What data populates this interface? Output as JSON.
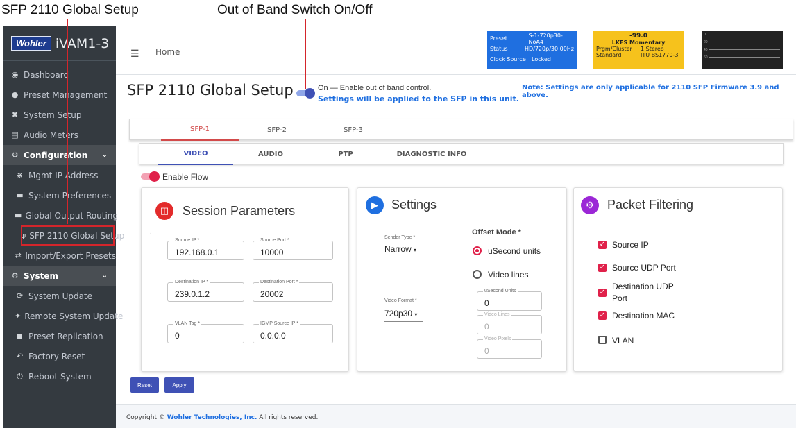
{
  "callouts": {
    "global_setup": "SFP 2110 Global Setup",
    "oob_switch": "Out of Band Switch On/Off"
  },
  "brand": {
    "logo": "Wohler",
    "name": "iVAM1-3"
  },
  "sidebar": {
    "items": [
      {
        "label": "Dashboard",
        "icon": "palette-icon"
      },
      {
        "label": "Preset Management",
        "icon": "user-cog-icon"
      },
      {
        "label": "System Setup",
        "icon": "tools-icon"
      },
      {
        "label": "Audio Meters",
        "icon": "chart-icon"
      },
      {
        "label": "Configuration",
        "icon": "gear-icon"
      },
      {
        "label": "Mgmt IP Address",
        "icon": "network-icon"
      },
      {
        "label": "System Preferences",
        "icon": "keyboard-icon"
      },
      {
        "label": "Global Output Routing",
        "icon": "keyboard-icon"
      },
      {
        "label": "SFP 2110 Global Setup",
        "icon": "plug-icon"
      },
      {
        "label": "Import/Export Presets",
        "icon": "swap-icon"
      },
      {
        "label": "System",
        "icon": "cogs-icon"
      },
      {
        "label": "System Update",
        "icon": "sync-icon"
      },
      {
        "label": "Remote System Update",
        "icon": "satellite-icon"
      },
      {
        "label": "Preset Replication",
        "icon": "copy-icon"
      },
      {
        "label": "Factory Reset",
        "icon": "undo-icon"
      },
      {
        "label": "Reboot System",
        "icon": "power-icon"
      }
    ]
  },
  "header": {
    "home": "Home",
    "status": {
      "preset_k": "Preset",
      "preset_v": "S-1-720p30-NoA4",
      "status_k": "Status",
      "status_v": "HD/720p/30.00Hz",
      "clock_k": "Clock Source",
      "clock_v": "Locked"
    },
    "loudness": {
      "value": "-99.0",
      "mode": "LKFS  Momentary",
      "cluster_k": "Prgm/Cluster",
      "cluster_v": "1  Stereo",
      "standard_k": "Standard",
      "standard_v": "ITU BS1770-3"
    },
    "meter_ticks": [
      "0",
      "20",
      "40",
      "60"
    ]
  },
  "page": {
    "title": "SFP 2110 Global Setup",
    "oob_text": "On — Enable out of band control.",
    "oob_sub": "Settings will be applied to the SFP in this unit.",
    "oob_enabled": true,
    "note": "Note: Settings are only applicable for 2110 SFP Firmware 3.9 and above."
  },
  "sfp_tabs": [
    "SFP-1",
    "SFP-2",
    "SFP-3"
  ],
  "sub_tabs": [
    "VIDEO",
    "AUDIO",
    "PTP",
    "DIAGNOSTIC INFO"
  ],
  "enable_flow": {
    "label": "Enable Flow",
    "enabled": true
  },
  "session": {
    "title": "Session Parameters",
    "dot": ".",
    "fields": {
      "source_ip": {
        "label": "Source IP *",
        "value": "192.168.0.1"
      },
      "source_port": {
        "label": "Source Port *",
        "value": "10000"
      },
      "dest_ip": {
        "label": "Destination IP *",
        "value": "239.0.1.2"
      },
      "dest_port": {
        "label": "Destination Port *",
        "value": "20002"
      },
      "vlan": {
        "label": "VLAN Tag *",
        "value": "0"
      },
      "igmp": {
        "label": "IGMP Source IP *",
        "value": "0.0.0.0"
      }
    }
  },
  "settings": {
    "title": "Settings",
    "sender_type_label": "Sender Type *",
    "sender_type": "Narrow",
    "video_format_label": "Video Format *",
    "video_format": "720p30",
    "offset_mode_label": "Offset Mode *",
    "usecond_label": "uSecond units",
    "videolines_label": "Video lines",
    "usecond_units": {
      "label": "uSecond Units",
      "value": "0"
    },
    "video_lines": {
      "label": "Video Lines",
      "value": "0"
    },
    "video_pixels": {
      "label": "Video Pixels",
      "value": "0"
    }
  },
  "filtering": {
    "title": "Packet Filtering",
    "items": [
      {
        "label": "Source IP",
        "checked": true
      },
      {
        "label": "Source UDP Port",
        "checked": true
      },
      {
        "label": "Destination UDP",
        "label2": "Port",
        "checked": true
      },
      {
        "label": "Destination MAC",
        "checked": true
      },
      {
        "label": "VLAN",
        "checked": false
      }
    ]
  },
  "buttons": {
    "reset": "Reset",
    "apply": "Apply"
  },
  "footer": {
    "prefix": "Copyright © ",
    "company": "Wohler Technologies, Inc.",
    "suffix": "  All rights reserved."
  },
  "colors": {
    "accent": "#3f51b5",
    "pink": "#e0214a",
    "callout": "#d4252b"
  }
}
